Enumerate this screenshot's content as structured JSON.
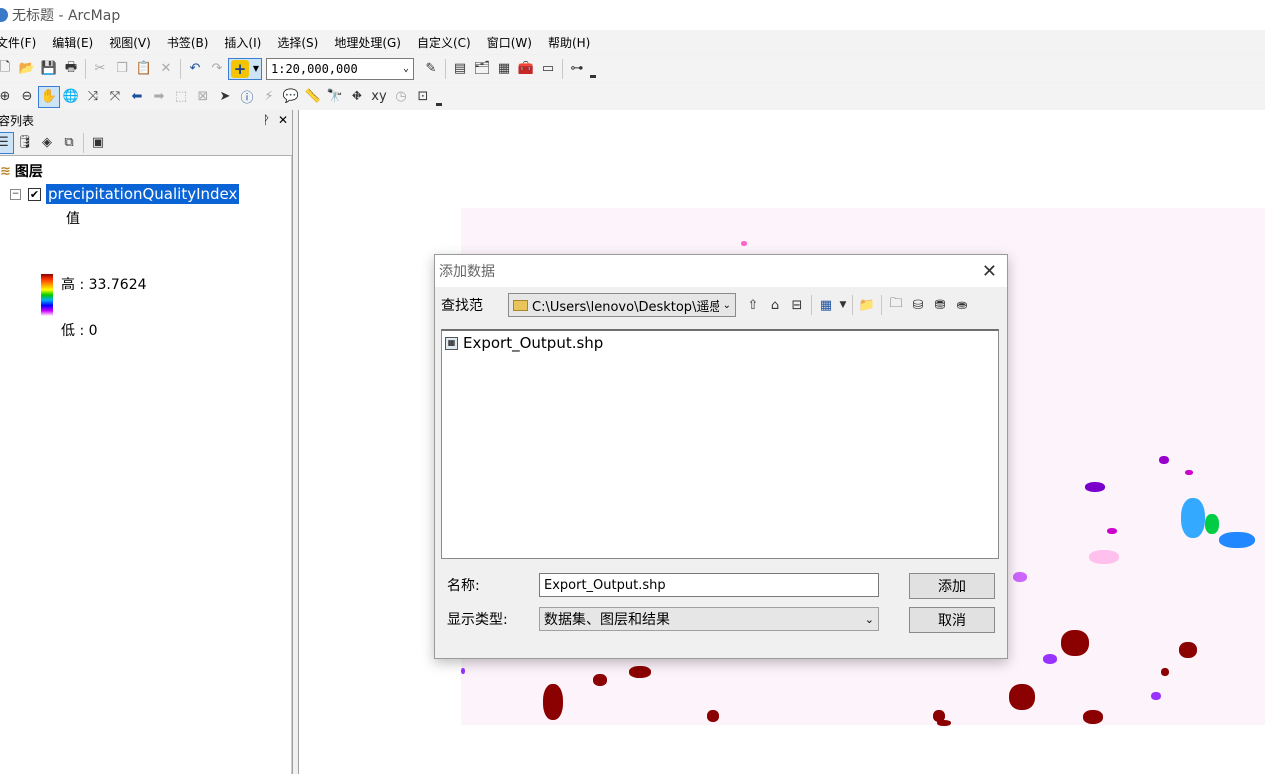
{
  "window": {
    "title": "无标题 - ArcMap"
  },
  "menu": [
    "文件(F)",
    "编辑(E)",
    "视图(V)",
    "书签(B)",
    "插入(I)",
    "选择(S)",
    "地理处理(G)",
    "自定义(C)",
    "窗口(W)",
    "帮助(H)"
  ],
  "toolbar": {
    "scale_value": "1:20,000,000"
  },
  "toc": {
    "title": "容列表",
    "pin": "ᚹ",
    "close": "✕",
    "layers_label": "图层",
    "layer_name": "precipitationQualityIndex",
    "layer_checked": "✔",
    "layer_expander": "−",
    "legend_title": "值",
    "legend_high": "高 : 33.7624",
    "legend_low": "低 : 0"
  },
  "dialog": {
    "title": "添加数据",
    "look_in_label": "查找范",
    "path": "C:\\Users\\lenovo\\Desktop\\遥感\\",
    "files": [
      "Export_Output.shp"
    ],
    "name_label": "名称:",
    "name_value": "Export_Output.shp",
    "type_label": "显示类型:",
    "type_value": "数据集、图层和结果",
    "add_button": "添加",
    "cancel_button": "取消"
  }
}
